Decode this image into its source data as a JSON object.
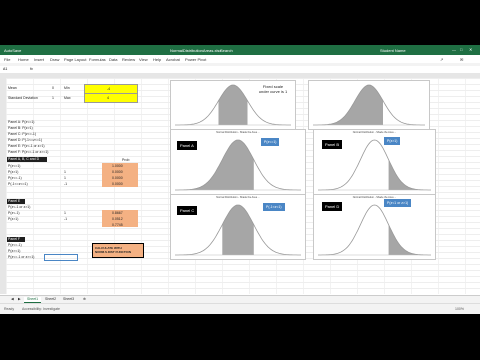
{
  "window": {
    "autosave": "AutoSave",
    "filename": "NormalDistributionAreas.xlsx",
    "search": "Search",
    "user": "Student Name"
  },
  "menu": [
    "File",
    "Home",
    "Insert",
    "Draw",
    "Page Layout",
    "Formulas",
    "Data",
    "Review",
    "View",
    "Help",
    "Acrobat",
    "Power Pivot"
  ],
  "formula": {
    "namebox": "A1",
    "fx": "fx",
    "value": ""
  },
  "cells": {
    "mean_label": "Mean",
    "mean_val": "0",
    "sd_label": "Standard Deviation",
    "sd_val": "1",
    "min_label": "Min",
    "min_val": "-4",
    "max_label": "Max",
    "max_val": "4",
    "rowA": "Panel A: P(z<=1)",
    "rowB": "Panel B: P(z>1)",
    "rowC": "Panel C: P(z<=-1)",
    "rowD": "Panel D: P(-1<=z<=1)",
    "rowE": "Panel E: P(z<-1 or z>1)",
    "rowF": "Panel F: P(z<=-1 or z>=1)",
    "block1_head": "Panel A, B, C and D",
    "prob_head": "Prob",
    "b1_r1": "P(z<=1)",
    "b1_r2": "P(z>1)",
    "b1_r3": "P(z<=-1)",
    "b1_r4": "P(-1<=z<=1)",
    "block2_head": "Panel E",
    "b2_r1": "P(z<-1 or z>1)",
    "b2_r2": "P(z<-1)",
    "b2_r3": "P(z>1)",
    "block3_head": "Panel F",
    "b3_r1": "P(z<=-1)",
    "b3_r2": "P(z>=1)",
    "b3_r3": "P(z<=-1 or z>=1)",
    "v1": "1",
    "v2": "1",
    "v3": "-1",
    "v5": "1",
    "v6": "-1",
    "p1": "1.0000",
    "p2": "0.0000",
    "p3": "0.0000",
    "p4": "0.0000",
    "p5": "0.8667",
    "p6": "0.0512",
    "p7": "0.7745",
    "fn_text": "CALCULATE WITH NORM.S.DIST FUNCTION"
  },
  "charts": [
    {
      "id": "top-left",
      "shade": "center"
    },
    {
      "id": "top-right",
      "shade": "left"
    },
    {
      "id": "panel-a",
      "title": "Normal Distribution - Shade the Area ...",
      "panel": "Panel A",
      "prob": "P(z<=1)",
      "shade": "left"
    },
    {
      "id": "panel-b",
      "title": "Normal Distribution - Shade the Area ...",
      "panel": "Panel B",
      "prob": "P(z>1)",
      "shade": "right"
    },
    {
      "id": "panel-c",
      "title": "Normal Distribution - Shade the Area ...",
      "panel": "Panel C",
      "prob": "P(-1<z<1)",
      "shade": "center"
    },
    {
      "id": "panel-d",
      "title": "Normal Distribution - Shade the Area ...",
      "panel": "Panel D",
      "prob": "P(z<1 or z>1)",
      "shade": "right"
    }
  ],
  "note": {
    "line1": "Fixed scale",
    "line2": "under curve is 1"
  },
  "tabs": [
    "Sheet1",
    "Sheet2",
    "Sheet3"
  ],
  "status": {
    "left": "Ready",
    "mid": "Accessibility: Investigate",
    "right": "100%"
  },
  "colors": {
    "excel_green": "#1f6f43",
    "yellow": "#ffff00",
    "salmon": "#f4b183",
    "panel_blue": "#4a86c5",
    "shade": "#a6a6a6"
  }
}
